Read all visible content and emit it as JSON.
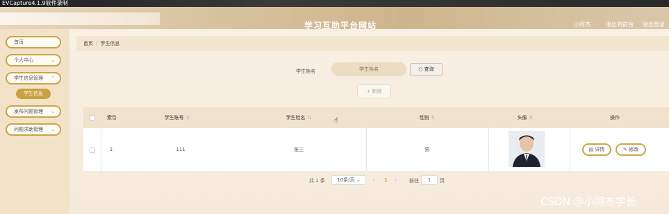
{
  "capture": {
    "text": "EVCapture4.1.9软件录制"
  },
  "header": {
    "title": "学习互助平台网站",
    "links": [
      "小阿杰",
      "退出到前台",
      "退出登录"
    ]
  },
  "sidebar": {
    "items": [
      {
        "label": "首页"
      },
      {
        "label": "个人中心"
      },
      {
        "label": "学生信息管理"
      },
      {
        "label": "学生信息"
      },
      {
        "label": "发布问题管理"
      },
      {
        "label": "问题求助管理"
      }
    ]
  },
  "breadcrumb": {
    "home": "首页",
    "current": "学生信息"
  },
  "search": {
    "label": "学生姓名",
    "placeholder": "学生姓名",
    "query_label": "查询"
  },
  "toolbar": {
    "add_label": "+ 新增"
  },
  "table": {
    "columns": [
      "索引",
      "学生账号",
      "学生姓名",
      "性别",
      "头像",
      "操作"
    ],
    "rows": [
      {
        "index": "1",
        "account": "111",
        "name": "张三",
        "gender": "男"
      }
    ],
    "actions": {
      "detail": "详情",
      "edit": "修改"
    }
  },
  "pagination": {
    "total": "共 1 条",
    "page_size": "10条/页",
    "current_page": "1",
    "goto_label": "前往",
    "goto_value": "1",
    "page_suffix": "页"
  },
  "watermark": "CSDN @小阿杰学长",
  "colors": {
    "accent": "#caa646",
    "header": "#d9c3a0",
    "sidebar": "#f1e2c8"
  }
}
